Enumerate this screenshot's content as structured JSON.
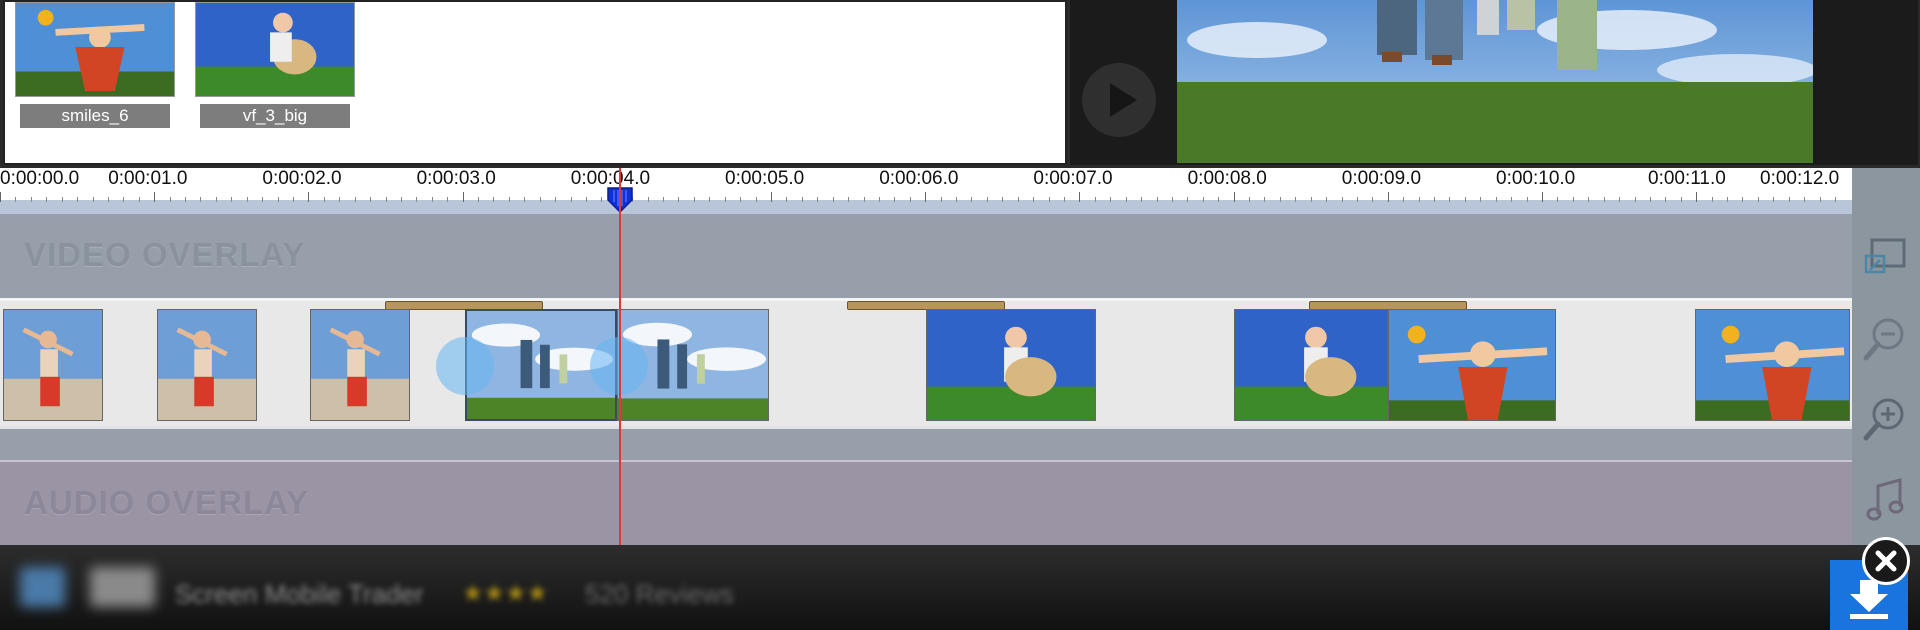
{
  "library": {
    "items": [
      {
        "name": "smiles_6"
      },
      {
        "name": "vf_3_big"
      }
    ]
  },
  "preview": {
    "play_icon": "play-icon"
  },
  "timeline": {
    "ticks": [
      "0:00:00.0",
      "0:00:01.0",
      "0:00:02.0",
      "0:00:03.0",
      "0:00:04.0",
      "0:00:05.0",
      "0:00:06.0",
      "0:00:07.0",
      "0:00:08.0",
      "0:00:09.0",
      "0:00:10.0",
      "0:00:11.0",
      "0:00:12.0"
    ],
    "playhead_time_seconds": 4.0,
    "video_overlay_label": "VIDEO OVERLAY",
    "audio_overlay_label": "AUDIO OVERLAY"
  },
  "tools": {
    "icons": [
      "crop-overlay-icon",
      "zoom-out-icon",
      "zoom-in-icon",
      "music-note-icon"
    ]
  },
  "ad": {
    "text": "Screen Mobile Trader",
    "stars": "★★★★",
    "reviews": "520 Reviews",
    "download_icon": "download-arrow-icon",
    "close_icon": "close-icon"
  },
  "colors": {
    "playhead": "#e03838",
    "download_button": "#1a74e0",
    "transition_bar": "#b8955a"
  }
}
